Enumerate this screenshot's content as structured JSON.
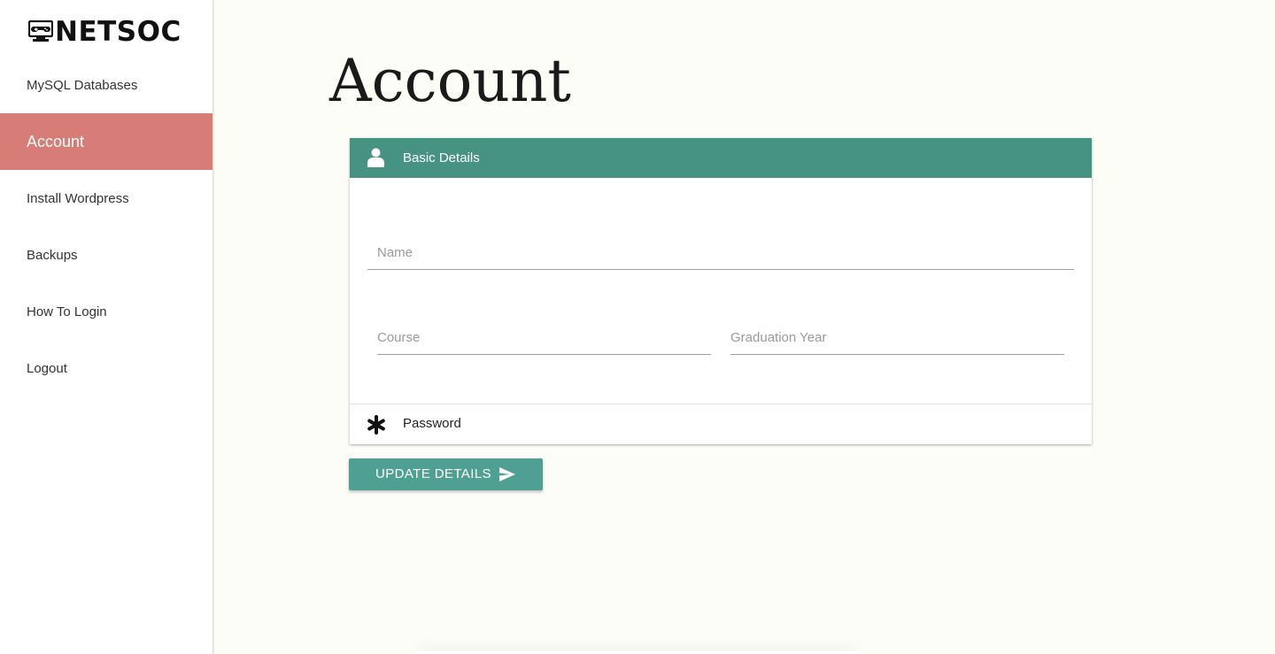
{
  "brand": {
    "name": "NETSOC",
    "logo_icon": "computer-gamepad-icon"
  },
  "sidebar": {
    "items": [
      {
        "label": "MySQL Databases",
        "active": false
      },
      {
        "label": "Account",
        "active": true
      },
      {
        "label": "Install Wordpress",
        "active": false
      },
      {
        "label": "Backups",
        "active": false
      },
      {
        "label": "How To Login",
        "active": false
      },
      {
        "label": "Logout",
        "active": false
      }
    ]
  },
  "page": {
    "title": "Account"
  },
  "card": {
    "header": {
      "label": "Basic Details",
      "icon": "person-icon"
    },
    "fields": {
      "name": {
        "value": "",
        "placeholder": "Name"
      },
      "course": {
        "value": "",
        "placeholder": "Course"
      },
      "graduation_year": {
        "value": "",
        "placeholder": "Graduation Year"
      }
    },
    "password_section": {
      "label": "Password",
      "icon": "asterisk-icon"
    }
  },
  "actions": {
    "update_label": "UPDATE DETAILS",
    "update_icon": "send-icon"
  },
  "colors": {
    "accent_teal": "#469384",
    "button_teal": "#4fa093",
    "active_nav": "#d77c77",
    "background": "#fdfdf8"
  }
}
